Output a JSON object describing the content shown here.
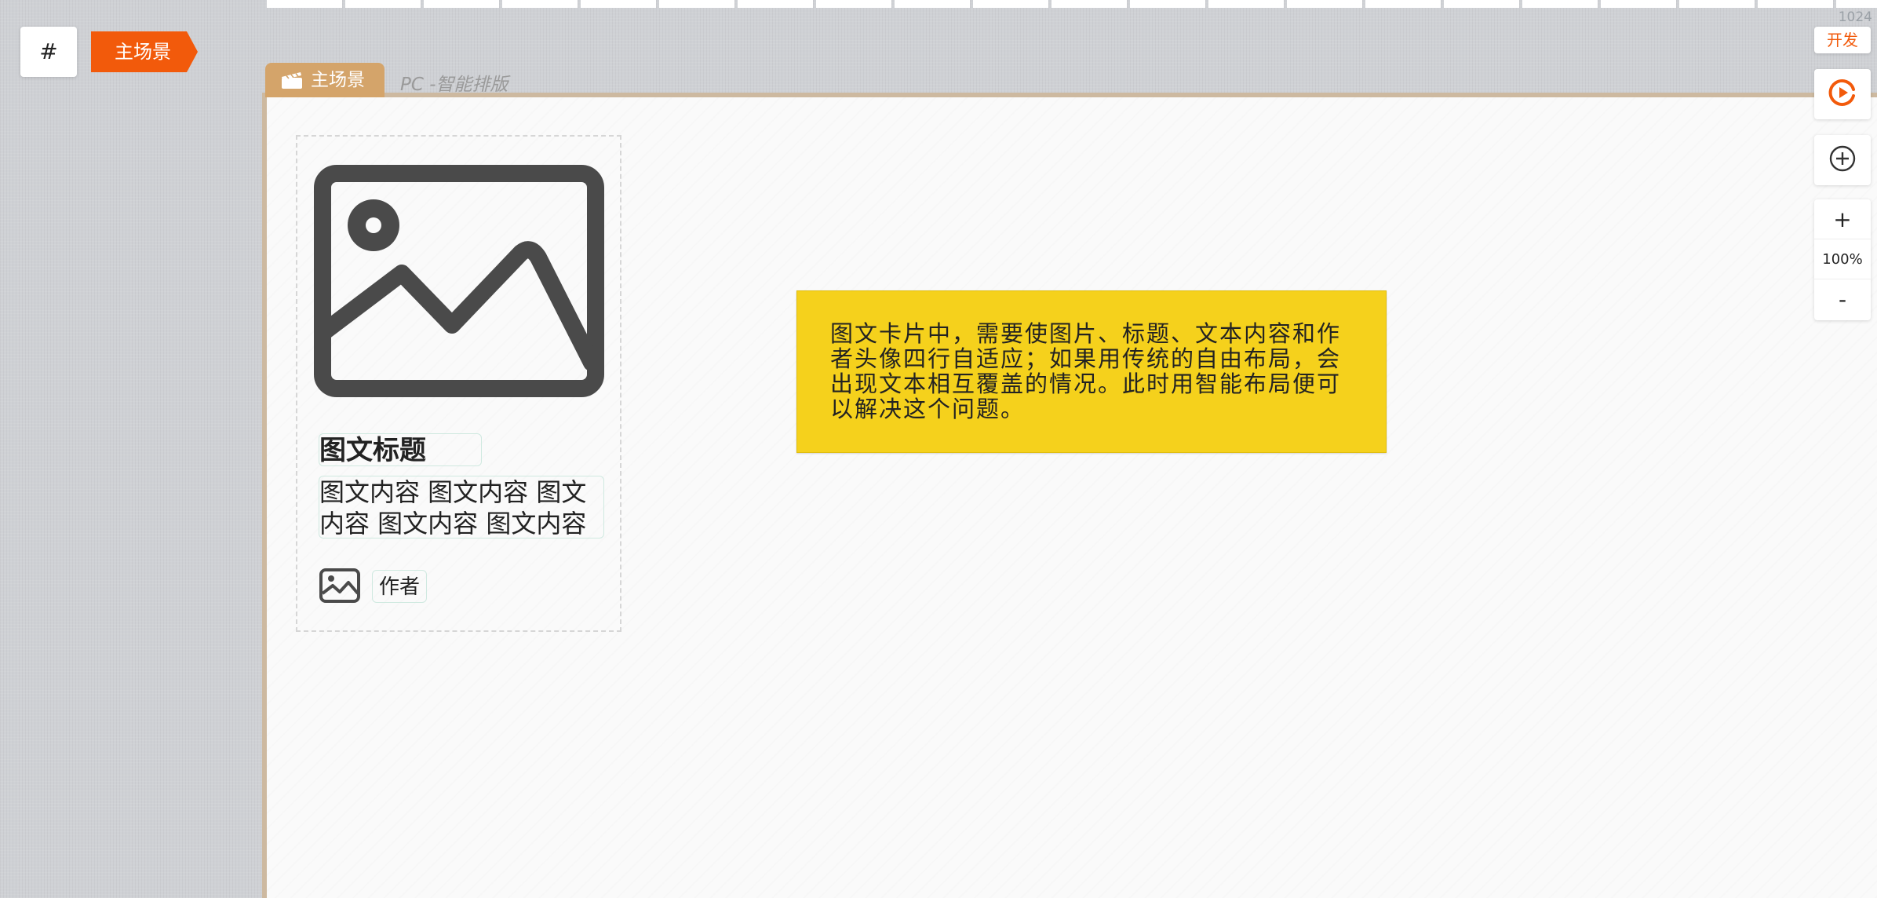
{
  "ruler": {
    "width_label": "1024"
  },
  "scene": {
    "hash_label": "#",
    "tag_label": "主场景"
  },
  "canvas": {
    "tab_label": "主场景",
    "layout_mode": "PC -智能排版"
  },
  "card": {
    "image_icon": "image-icon",
    "title": "图文标题",
    "body": "图文内容 图文内容 图文内容 图文内容 图文内容",
    "avatar_icon": "image-icon",
    "author": "作者"
  },
  "note": {
    "text": "图文卡片中，需要使图片、标题、文本内容和作者头像四行自适应；如果用传统的自由布局，会出现文本相互覆盖的情况。此时用智能布局便可以解决这个问题。"
  },
  "tools": {
    "dev_label": "开发",
    "preview_icon": "play-icon",
    "add_icon": "plus-circle-icon",
    "zoom_in": "+",
    "zoom_level": "100%",
    "zoom_out": "-"
  },
  "colors": {
    "accent": "#f25a0b",
    "tab": "#d4a46a",
    "note": "#f5d11c",
    "icon": "#4a4a4a"
  }
}
